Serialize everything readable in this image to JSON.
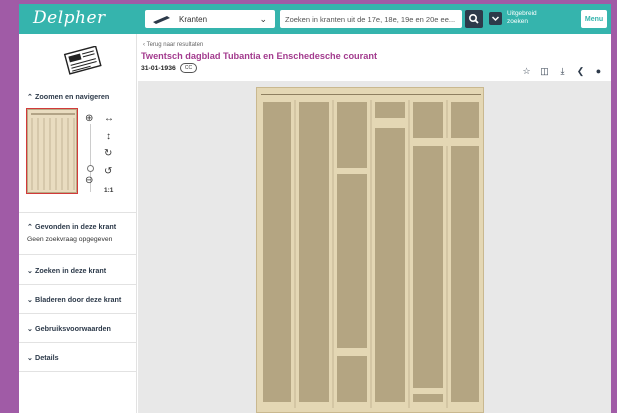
{
  "header": {
    "logo": "Delpher",
    "collection": "Kranten",
    "search_placeholder": "Zoeken in kranten uit de 17e, 18e, 19e en 20e ee...",
    "advanced_line1": "Uitgebreid",
    "advanced_line2": "zoeken",
    "menu": "Menu"
  },
  "sidebar": {
    "zoom_heading": "Zoomen en navigeren",
    "zoom_ratio": "1:1",
    "found_heading": "Gevonden in deze krant",
    "found_text": "Geen zoekvraag opgegeven",
    "search_heading": "Zoeken in deze krant",
    "browse_heading": "Bladeren door deze krant",
    "terms_heading": "Gebruiksvoorwaarden",
    "details_heading": "Details"
  },
  "doc": {
    "back": "Terug naar resultaten",
    "title": "Twentsch dagblad Tubantia en Enschedesche courant",
    "date": "31-01-1936",
    "license": "CC"
  },
  "colors": {
    "brand": "#35b4ad",
    "title": "#a33b8e",
    "navy": "#2d3a4a"
  }
}
